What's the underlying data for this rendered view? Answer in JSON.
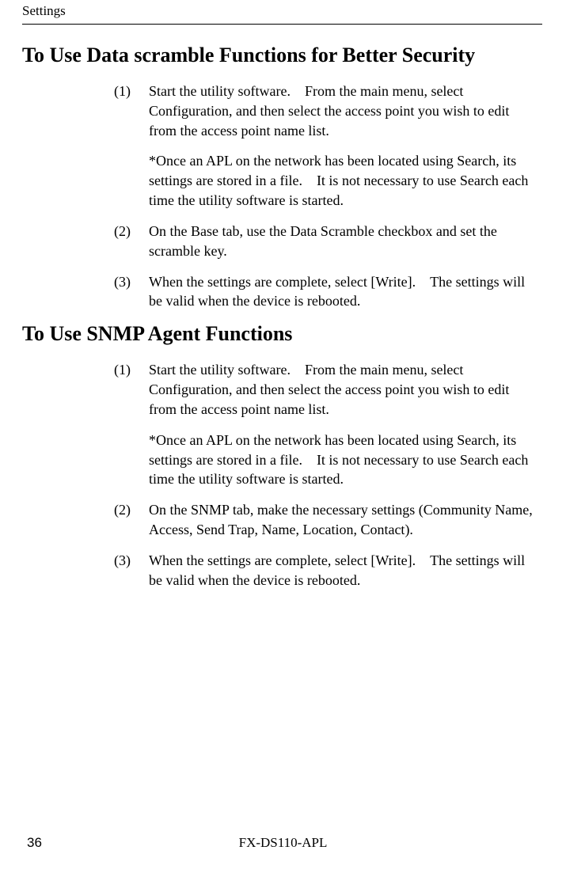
{
  "header": {
    "title": "Settings"
  },
  "section1": {
    "title": "To Use Data scramble Functions for Better Security",
    "item1_marker": "(1)",
    "item1_text": "Start the utility software. From the main menu, select Configuration, and then select the access point you wish to edit from the access point name list.",
    "item1_note": "*Once an APL on the network has been located using Search, its settings are stored in a file. It is not necessary to use Search each time the utility software is started.",
    "item2_marker": "(2)",
    "item2_text": "On the Base tab, use the Data Scramble checkbox and set the scramble key.",
    "item3_marker": "(3)",
    "item3_text": "When the settings are complete, select [Write]. The settings will be valid when the device is rebooted."
  },
  "section2": {
    "title": "To Use SNMP Agent Functions",
    "item1_marker": "(1)",
    "item1_text": "Start the utility software. From the main menu, select Configuration, and then select the access point you wish to edit from the access point name list.",
    "item1_note": "*Once an APL on the network has been located using Search, its settings are stored in a file. It is not necessary to use Search each time the utility software is started.",
    "item2_marker": "(2)",
    "item2_text": "On the SNMP tab, make the necessary settings (Community Name, Access, Send Trap, Name, Location, Contact).",
    "item3_marker": "(3)",
    "item3_text": "When the settings are complete, select [Write]. The settings will be valid when the device is rebooted."
  },
  "footer": {
    "page_number": "36",
    "center_text": "FX-DS110-APL"
  }
}
